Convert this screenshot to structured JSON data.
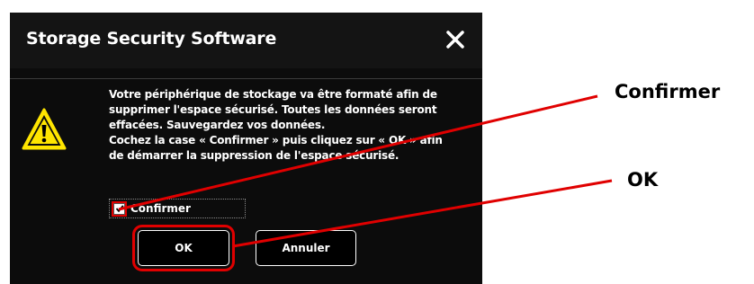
{
  "dialog": {
    "title": "Storage Security Software",
    "message_lines": [
      "Votre périphérique de stockage va être formaté afin de",
      "supprimer l'espace sécurisé. Toutes les données seront",
      "effacées. Sauvegardez vos données.",
      "Cochez la case « Confirmer » puis cliquez sur « OK » afin",
      "de démarrer la suppression de l'espace sécurisé."
    ],
    "checkbox_label": "Confirmer",
    "checkbox_checked": true,
    "ok_label": "OK",
    "cancel_label": "Annuler"
  },
  "annotations": {
    "confirm_label": "Confirmer",
    "ok_label": "OK",
    "highlight_color": "#e00000"
  },
  "icons": {
    "close": "close-icon",
    "warning": "warning-icon",
    "check": "checkmark-icon"
  }
}
